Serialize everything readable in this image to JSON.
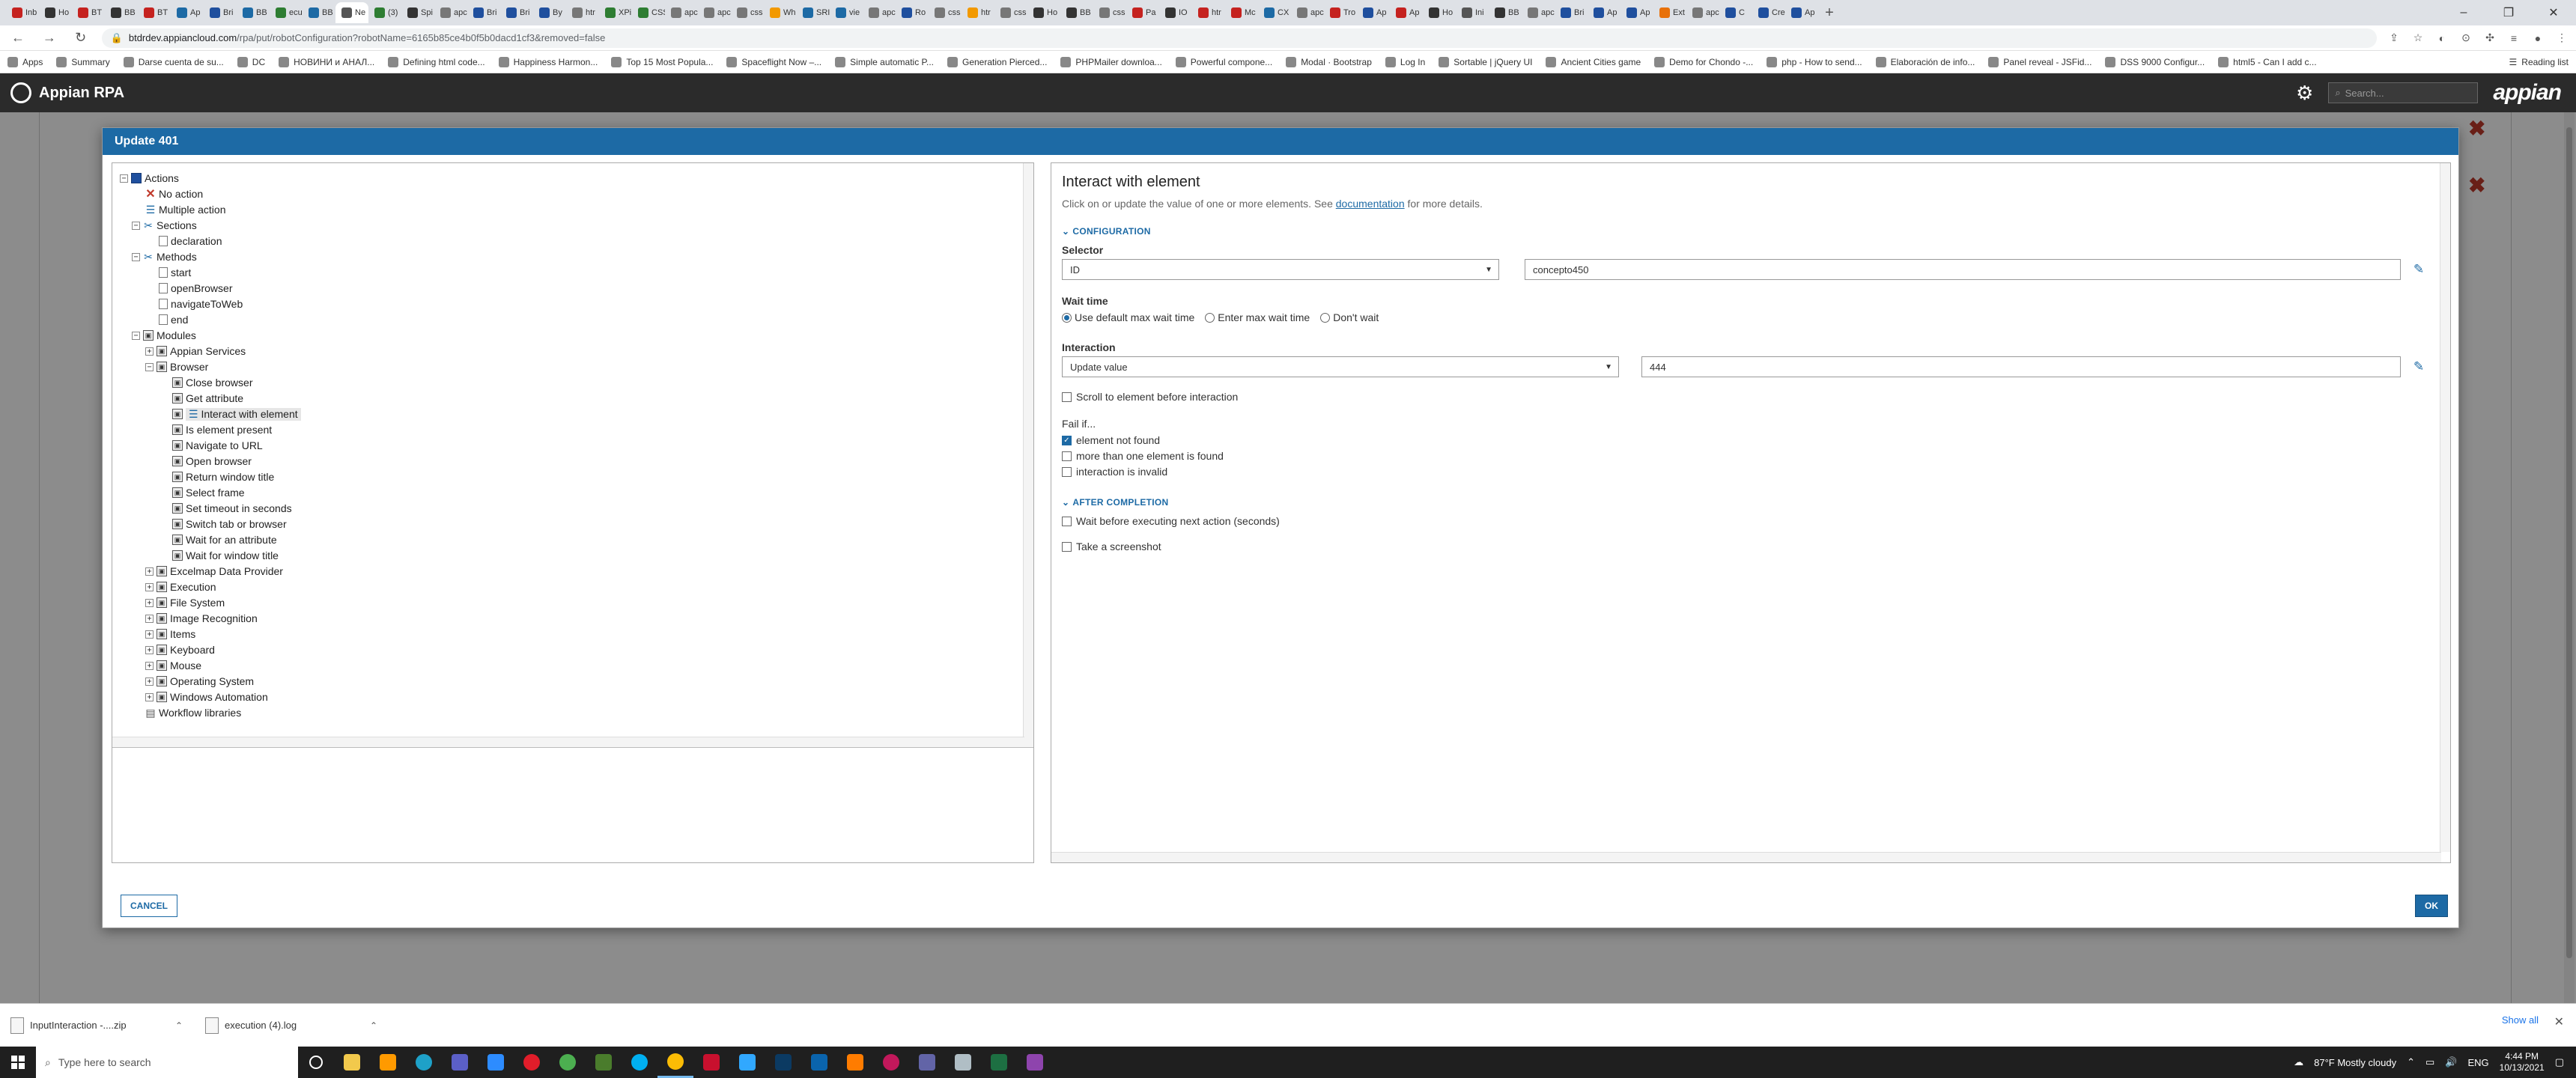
{
  "browser": {
    "tabs": [
      {
        "label": "Inb",
        "color": "#c5221f"
      },
      {
        "label": "Ho",
        "color": "#333333"
      },
      {
        "label": "BT",
        "color": "#c5221f"
      },
      {
        "label": "BB",
        "color": "#333333"
      },
      {
        "label": "BT",
        "color": "#c5221f"
      },
      {
        "label": "Ap",
        "color": "#1d6aa5"
      },
      {
        "label": "Bri",
        "color": "#1f4f9e"
      },
      {
        "label": "BB",
        "color": "#1d6aa5"
      },
      {
        "label": "ecu",
        "color": "#2e7d32"
      },
      {
        "label": "BB",
        "color": "#1d6aa5"
      },
      {
        "label": "Ne",
        "color": "#555555"
      },
      {
        "label": "(3)",
        "color": "#2e7d32"
      },
      {
        "label": "Spi",
        "color": "#333333"
      },
      {
        "label": "apc",
        "color": "#777777"
      },
      {
        "label": "Bri",
        "color": "#1f4f9e"
      },
      {
        "label": "Bri",
        "color": "#1f4f9e"
      },
      {
        "label": "By",
        "color": "#1f4f9e"
      },
      {
        "label": "htr",
        "color": "#777777"
      },
      {
        "label": "XPi",
        "color": "#2e7d32"
      },
      {
        "label": "CSS",
        "color": "#2e7d32"
      },
      {
        "label": "apc",
        "color": "#777777"
      },
      {
        "label": "apc",
        "color": "#777777"
      },
      {
        "label": "css",
        "color": "#777777"
      },
      {
        "label": "Wh",
        "color": "#f29900"
      },
      {
        "label": "SRI",
        "color": "#1d6aa5"
      },
      {
        "label": "vie",
        "color": "#1d6aa5"
      },
      {
        "label": "apc",
        "color": "#777777"
      },
      {
        "label": "Ro",
        "color": "#1f4f9e"
      },
      {
        "label": "css",
        "color": "#777777"
      },
      {
        "label": "htr",
        "color": "#f29900"
      },
      {
        "label": "css",
        "color": "#777777"
      },
      {
        "label": "Ho",
        "color": "#333333"
      },
      {
        "label": "BB",
        "color": "#333333"
      },
      {
        "label": "css",
        "color": "#777777"
      },
      {
        "label": "Pa",
        "color": "#c5221f"
      },
      {
        "label": "IO",
        "color": "#333333"
      },
      {
        "label": "htr",
        "color": "#c5221f"
      },
      {
        "label": "Mc",
        "color": "#c5221f"
      },
      {
        "label": "CX",
        "color": "#1d6aa5"
      },
      {
        "label": "apc",
        "color": "#777777"
      },
      {
        "label": "Tro",
        "color": "#c5221f"
      },
      {
        "label": "Ap",
        "color": "#1f4f9e"
      },
      {
        "label": "Ap",
        "color": "#c5221f"
      },
      {
        "label": "Ho",
        "color": "#333333"
      },
      {
        "label": "Ini",
        "color": "#555555"
      },
      {
        "label": "BB",
        "color": "#333333"
      },
      {
        "label": "apc",
        "color": "#777777"
      },
      {
        "label": "Bri",
        "color": "#1f4f9e"
      },
      {
        "label": "Ap",
        "color": "#1f4f9e"
      },
      {
        "label": "Ap",
        "color": "#1f4f9e"
      },
      {
        "label": "Ext",
        "color": "#e8710a"
      },
      {
        "label": "apc",
        "color": "#777777"
      },
      {
        "label": "C",
        "color": "#1f4f9e"
      },
      {
        "label": "Cre",
        "color": "#1f4f9e"
      },
      {
        "label": "Ap",
        "color": "#1f4f9e"
      }
    ],
    "active_tab_index": 10,
    "new_tab_symbol": "+",
    "url_host": "btdrdev.appiancloud.com",
    "url_path": "/rpa/put/robotConfiguration?robotName=6165b85ce4b0f5b0dacd1cf3&removed=false",
    "bookmarks": [
      "Apps",
      "Summary",
      "Darse cuenta de su...",
      "DC",
      "НОВИНИ и АНАЛ...",
      "Defining html code...",
      "Happiness Harmon...",
      "Top 15 Most Popula...",
      "Spaceflight Now –...",
      "Simple automatic P...",
      "Generation Pierced...",
      "PHPMailer downloa...",
      "Powerful compone...",
      "Modal · Bootstrap",
      "Log In",
      "Sortable | jQuery UI",
      "Ancient Cities game",
      "Demo for Chondo -...",
      "php - How to send...",
      "Elaboración de info...",
      "Panel reveal - JSFid...",
      "DSS 9000 Configur...",
      "html5 - Can I add c..."
    ],
    "reading_list": "Reading list"
  },
  "appian": {
    "app_title": "Appian RPA",
    "search_placeholder": "Search...",
    "brand": "appian"
  },
  "modal": {
    "title": "Update 401",
    "cancel_label": "CANCEL",
    "ok_label": "OK"
  },
  "tree": {
    "actions": "Actions",
    "no_action": "No action",
    "multiple_action": "Multiple action",
    "sections": "Sections",
    "declaration": "declaration",
    "methods": "Methods",
    "start": "start",
    "openBrowser": "openBrowser",
    "navigateToWeb": "navigateToWeb",
    "end": "end",
    "modules": "Modules",
    "appian_services": "Appian Services",
    "browser": "Browser",
    "browser_items": [
      "Close browser",
      "Get attribute",
      "Interact with element",
      "Is element present",
      "Navigate to URL",
      "Open browser",
      "Return window title",
      "Select frame",
      "Set timeout in seconds",
      "Switch tab or browser",
      "Wait for an attribute",
      "Wait for window title"
    ],
    "modules_rest": [
      "Excelmap Data Provider",
      "Execution",
      "File System",
      "Image Recognition",
      "Items",
      "Keyboard",
      "Mouse",
      "Operating System",
      "Windows Automation"
    ],
    "workflow_libraries": "Workflow libraries"
  },
  "detail": {
    "title": "Interact with element",
    "desc_before": "Click on or update the value of one or more elements. See ",
    "desc_link": "documentation",
    "desc_after": " for more details.",
    "configuration": "CONFIGURATION",
    "selector_label": "Selector",
    "selector_type": "ID",
    "selector_value": "concepto450",
    "wait_time_label": "Wait time",
    "wait_options": [
      "Use default max wait time",
      "Enter max wait time",
      "Don't wait"
    ],
    "wait_selected": 0,
    "interaction_label": "Interaction",
    "interaction_type": "Update value",
    "interaction_value": "444",
    "scroll_label": "Scroll to element before interaction",
    "scroll_checked": false,
    "fail_if_label": "Fail if...",
    "fail_not_found": "element not found",
    "fail_not_found_checked": true,
    "fail_more_than_one": "more than one element is found",
    "fail_more_than_one_checked": false,
    "fail_invalid": "interaction is invalid",
    "fail_invalid_checked": false,
    "after_completion": "AFTER COMPLETION",
    "wait_before_next": "Wait before executing next action (seconds)",
    "wait_before_next_checked": false,
    "screenshot": "Take a screenshot",
    "screenshot_checked": false
  },
  "downloads": {
    "items": [
      "InputInteraction -....zip",
      "execution (4).log"
    ],
    "show_all": "Show all"
  },
  "taskbar": {
    "search_placeholder": "Type here to search",
    "weather": "87°F  Mostly cloudy",
    "lang": "ENG",
    "time": "4:44 PM",
    "date": "10/13/2021"
  }
}
